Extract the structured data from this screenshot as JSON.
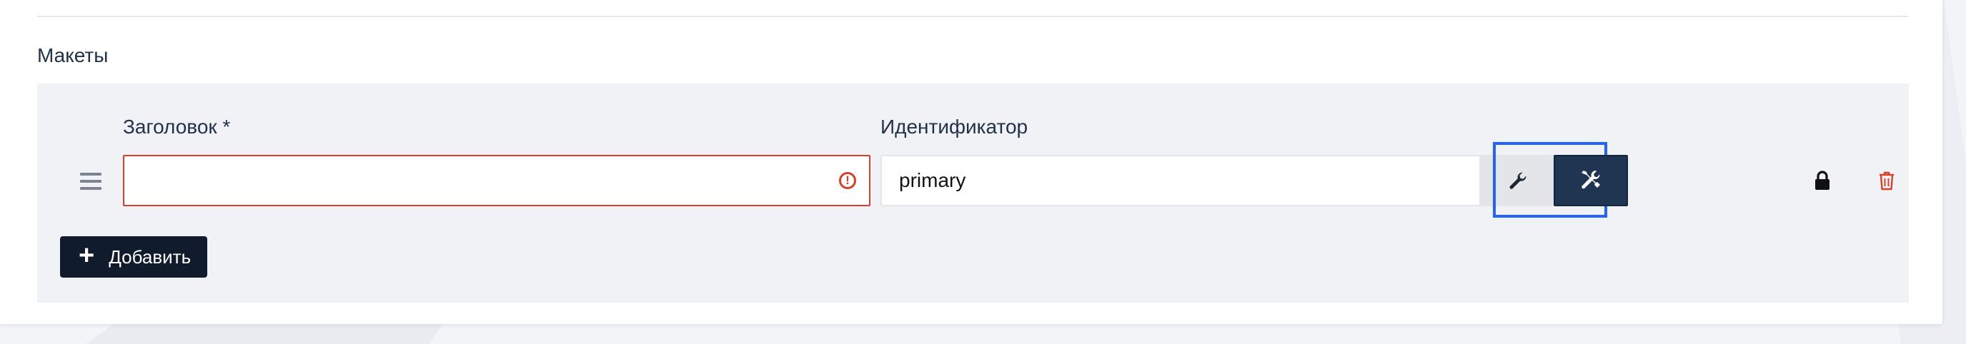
{
  "section": {
    "title": "Макеты"
  },
  "layout_item": {
    "title_label": "Заголовок *",
    "title_value": "",
    "title_error_icon": "!",
    "identifier_label": "Идентификатор",
    "identifier_value": "primary"
  },
  "actions": {
    "add_label": "Добавить",
    "add_icon": "+"
  },
  "icons": {
    "drag": "drag-handle-icon",
    "error": "error-circle-icon",
    "wrench": "wrench-icon",
    "tools": "tools-icon",
    "lock": "lock-icon",
    "delete": "trash-icon"
  },
  "colors": {
    "error": "#d8402c",
    "primary_dark": "#1f3552",
    "add_button": "#101c2c",
    "highlight": "#2463ff",
    "panel": "#f1f2f5"
  }
}
